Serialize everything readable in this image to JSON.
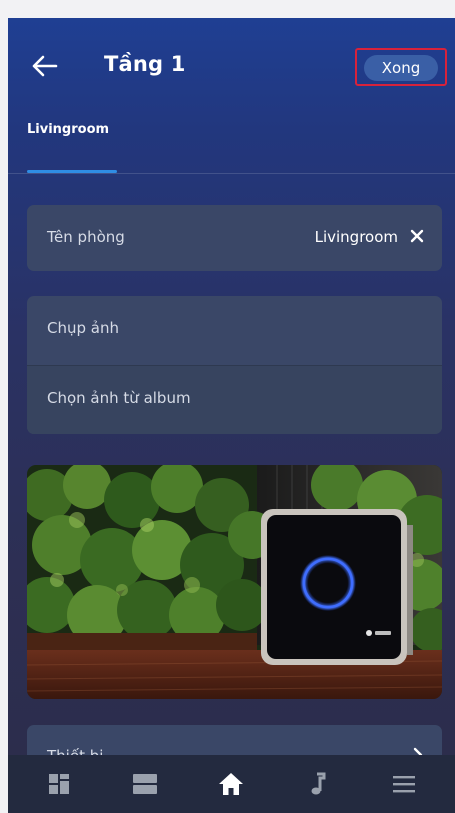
{
  "header": {
    "title": "Tầng 1",
    "done_label": "Xong"
  },
  "tabs": [
    {
      "label": "Livingroom",
      "active": true
    }
  ],
  "room_name": {
    "label": "Tên phòng",
    "value": "Livingroom"
  },
  "photo_options": [
    {
      "label": "Chụp ảnh"
    },
    {
      "label": "Chọn ảnh từ album"
    }
  ],
  "device": {
    "label": "Thiết bị"
  },
  "bottom_nav": [
    {
      "icon": "grid-icon",
      "active": false
    },
    {
      "icon": "rows-icon",
      "active": false
    },
    {
      "icon": "home-icon",
      "active": true
    },
    {
      "icon": "music-note-icon",
      "active": false
    },
    {
      "icon": "menu-icon",
      "active": false
    }
  ],
  "colors": {
    "accent": "#2f8de4",
    "done_button": "#3a5fa6",
    "highlight_border": "#d8223b",
    "card": "#3a4767",
    "nav_bar": "#232a3f"
  }
}
